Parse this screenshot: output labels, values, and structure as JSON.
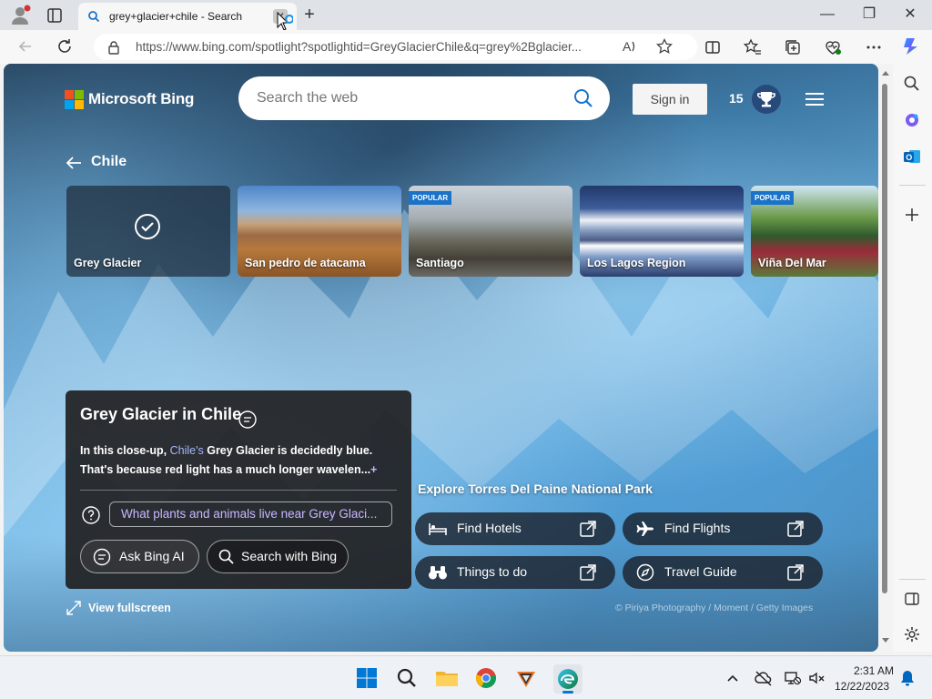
{
  "browser": {
    "tab": {
      "title": "grey+glacier+chile - Search",
      "close_glyph": "✕"
    },
    "new_tab_glyph": "+",
    "url": "https://www.bing.com/spotlight?spotlightid=GreyGlacierChile&q=grey%2Bglacier...",
    "window_controls": {
      "minimize": "—",
      "maximize": "❐",
      "close": "✕"
    }
  },
  "bing": {
    "logo_text": "Microsoft Bing",
    "search_placeholder": "Search the web",
    "sign_in": "Sign in",
    "reward_points": "15",
    "back_label": "Chile"
  },
  "cards": [
    {
      "label": "Grey Glacier",
      "popular": false,
      "selected": true
    },
    {
      "label": "San pedro de atacama",
      "popular": false
    },
    {
      "label": "Santiago",
      "popular": true
    },
    {
      "label": "Los Lagos Region",
      "popular": false
    },
    {
      "label": "Viña Del Mar",
      "popular": true
    }
  ],
  "popular_badge": "POPULAR",
  "info": {
    "title": "Grey Glacier in Chile",
    "desc_prefix": "In this close-up, ",
    "desc_link": "Chile's",
    "desc_rest": " Grey Glacier is decidedly blue. That's because red light has a much longer wavelen...",
    "more_glyph": "+",
    "suggestion": "What plants and animals live near Grey Glaci...",
    "ask_label": "Ask Bing AI",
    "search_label": "Search with Bing"
  },
  "explore": {
    "title": "Explore Torres Del Paine National Park",
    "buttons": [
      {
        "label": "Find Hotels",
        "icon": "bed-icon"
      },
      {
        "label": "Find Flights",
        "icon": "plane-icon"
      },
      {
        "label": "Things to do",
        "icon": "binoculars-icon"
      },
      {
        "label": "Travel Guide",
        "icon": "compass-icon"
      }
    ]
  },
  "fullscreen_label": "View fullscreen",
  "credit": "© Piriya Photography / Moment / Getty Images",
  "taskbar": {
    "time": "2:31 AM",
    "date": "12/22/2023"
  },
  "colors": {
    "accent": "#0078d4",
    "panel": "#212124",
    "link": "#a6b8ff"
  }
}
